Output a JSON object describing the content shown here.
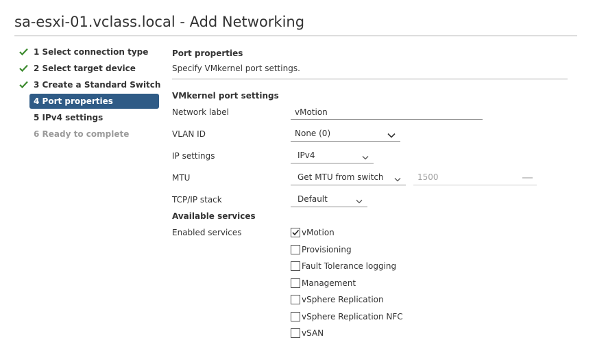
{
  "window": {
    "title": "sa-esxi-01.vclass.local - Add Networking"
  },
  "steps": [
    {
      "label": "1 Select connection type",
      "state": "done"
    },
    {
      "label": "2 Select target device",
      "state": "done"
    },
    {
      "label": "3 Create a Standard Switch",
      "state": "done"
    },
    {
      "label": "4 Port properties",
      "state": "active"
    },
    {
      "label": "5 IPv4 settings",
      "state": "pending"
    },
    {
      "label": "6 Ready to complete",
      "state": "disabled"
    }
  ],
  "page": {
    "heading": "Port properties",
    "description": "Specify VMkernel port settings."
  },
  "vmk": {
    "section_title": "VMkernel port settings",
    "network_label": {
      "label": "Network label",
      "value": "vMotion"
    },
    "vlan_id": {
      "label": "VLAN ID",
      "value": "None (0)"
    },
    "ip_settings": {
      "label": "IP settings",
      "value": "IPv4"
    },
    "mtu": {
      "label": "MTU",
      "mode": "Get MTU from switch",
      "value": "1500"
    },
    "tcpip_stack": {
      "label": "TCP/IP stack",
      "value": "Default"
    }
  },
  "services": {
    "section_title": "Available services",
    "label": "Enabled services",
    "items": [
      {
        "label": "vMotion",
        "checked": true
      },
      {
        "label": "Provisioning",
        "checked": false
      },
      {
        "label": "Fault Tolerance logging",
        "checked": false
      },
      {
        "label": "Management",
        "checked": false
      },
      {
        "label": "vSphere Replication",
        "checked": false
      },
      {
        "label": "vSphere Replication NFC",
        "checked": false
      },
      {
        "label": "vSAN",
        "checked": false
      }
    ]
  },
  "colors": {
    "active_step_bg": "#2f5b86",
    "check_green": "#3c8a2e"
  }
}
